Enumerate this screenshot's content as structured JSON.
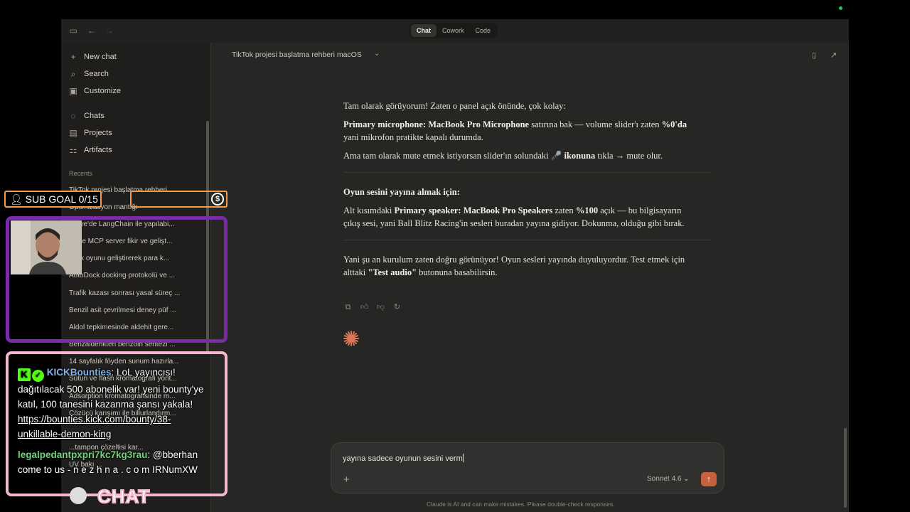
{
  "titlebar": {
    "tabs": [
      "Chat",
      "Cowork",
      "Code"
    ],
    "active_tab": "Chat"
  },
  "sidebar": {
    "nav": [
      {
        "label": "New chat",
        "icon": "plus-icon"
      },
      {
        "label": "Search",
        "icon": "search-icon"
      },
      {
        "label": "Customize",
        "icon": "briefcase-icon"
      },
      {
        "label": "Chats",
        "icon": "chat-bubble-icon"
      },
      {
        "label": "Projects",
        "icon": "folder-icon"
      },
      {
        "label": "Artifacts",
        "icon": "artifacts-icon"
      }
    ],
    "recents_label": "Recents",
    "recents": [
      "TikTok projesi başlatma rehberi ...",
      "Optimizasyon mantığı",
      "...kiye'de LangChain ile yapılabi...",
      "...kçe MCP server fikir ve gelişt...",
      "...lox oyunu geliştirerek para k...",
      "AutoDock docking protokolü ve ...",
      "Trafik kazası sonrası yasal süreç ...",
      "Benzil asit çevrilmesi deney püf ...",
      "Aldol tepkimesinde aldehit gere...",
      "Benzaldehitten benzoin sentezi ...",
      "14 sayfalık föyden sunum hazırla...",
      "Sütun ve flash kromatografi yönt...",
      "Adsorption kromatografisinde m...",
      "Çözücü karışımı ile billurlandırm...",
      "...",
      "...tampon çözeltisi kar...",
      "UV bakı ..."
    ]
  },
  "header": {
    "title": "TikTok projesi başlatma rehberi macOS"
  },
  "message": {
    "p1": "Tam olarak görüyorum! Zaten o panel açık önünde, çok kolay:",
    "p2_bold": "Primary microphone: MacBook Pro Microphone",
    "p2_rest": " satırına bak — volume slider'ı zaten ",
    "p2_bold2": "%0'da",
    "p2_end": " yani mikrofon pratikte kapalı durumda.",
    "p3_start": "Ama tam olarak mute etmek istiyorsan slider'ın solundaki 🎤 ",
    "p3_bold": "ikonuna",
    "p3_end": " tıkla → mute olur.",
    "h2": "Oyun sesini yayına almak için:",
    "p4_start": "Alt kısımdaki ",
    "p4_bold": "Primary speaker: MacBook Pro Speakers",
    "p4_mid": " zaten ",
    "p4_bold2": "%100",
    "p4_end": " açık — bu bilgisayarın çıkış sesi, yani Ball Blitz Racing'in sesleri buradan yayına gidiyor. Dokunma, olduğu gibi bırak.",
    "p5_start": "Yani şu an kurulum zaten doğru görünüyor! Oyun sesleri yayında duyuluyordur. Test etmek için alttaki ",
    "p5_bold": "\"Test audio\"",
    "p5_end": " butonuna basabilirsin."
  },
  "composer": {
    "text": "yayına sadece oyunun sesini verm",
    "model": "Sonnet 4.6",
    "disclaimer": "Claude is AI and can make mistakes. Please double-check responses."
  },
  "overlay": {
    "subgoal": "SUB GOAL 0/15",
    "chat_user1": "KICKBounties",
    "chat_msg1": ": LoL yayıncısı! dağıtılacak 500 abonelik var! yeni bounty'ye katıl, 100 tanesini kazanma şansı yakala!",
    "chat_link": "https://bounties.kick.com/bounty/38-unkillable-demon-king",
    "chat_user2": "legalpedantpxpri7kc7kg3rau",
    "chat_msg2": ": @bberhan come to us - n e z h n a . c o m IRNumXW",
    "chat_label": "CHAT"
  },
  "colors": {
    "accent": "#c6613f",
    "subgoal_border": "#f39b4a",
    "cam_frame": "#7b2aa8",
    "chat_frame": "#f4b7cf",
    "kick_green": "#53fc18"
  }
}
